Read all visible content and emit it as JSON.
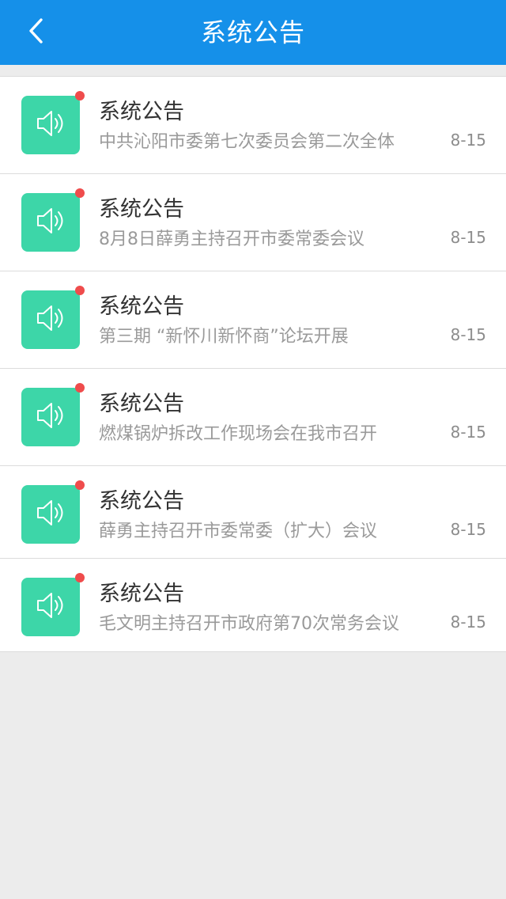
{
  "header": {
    "title": "系统公告",
    "back_icon": "chevron-left-icon",
    "background": "#1590e9"
  },
  "colors": {
    "icon_bg": "#3dd6a8",
    "unread_dot": "#ef4c4c"
  },
  "notices": [
    {
      "title": "系统公告",
      "summary": "中共沁阳市委第七次委员会第二次全体",
      "date": "8-15",
      "icon": "speaker-icon",
      "unread": true
    },
    {
      "title": "系统公告",
      "summary": "8月8日薛勇主持召开市委常委会议",
      "date": "8-15",
      "icon": "speaker-icon",
      "unread": true
    },
    {
      "title": "系统公告",
      "summary": "第三期 “新怀川新怀商”论坛开展",
      "date": "8-15",
      "icon": "speaker-icon",
      "unread": true
    },
    {
      "title": "系统公告",
      "summary": "燃煤锅炉拆改工作现场会在我市召开",
      "date": "8-15",
      "icon": "speaker-icon",
      "unread": true
    },
    {
      "title": "系统公告",
      "summary": "薛勇主持召开市委常委（扩大）会议",
      "date": "8-15",
      "icon": "speaker-icon",
      "unread": true
    },
    {
      "title": "系统公告",
      "summary": "毛文明主持召开市政府第70次常务会议",
      "date": "8-15",
      "icon": "speaker-icon",
      "unread": true
    }
  ]
}
